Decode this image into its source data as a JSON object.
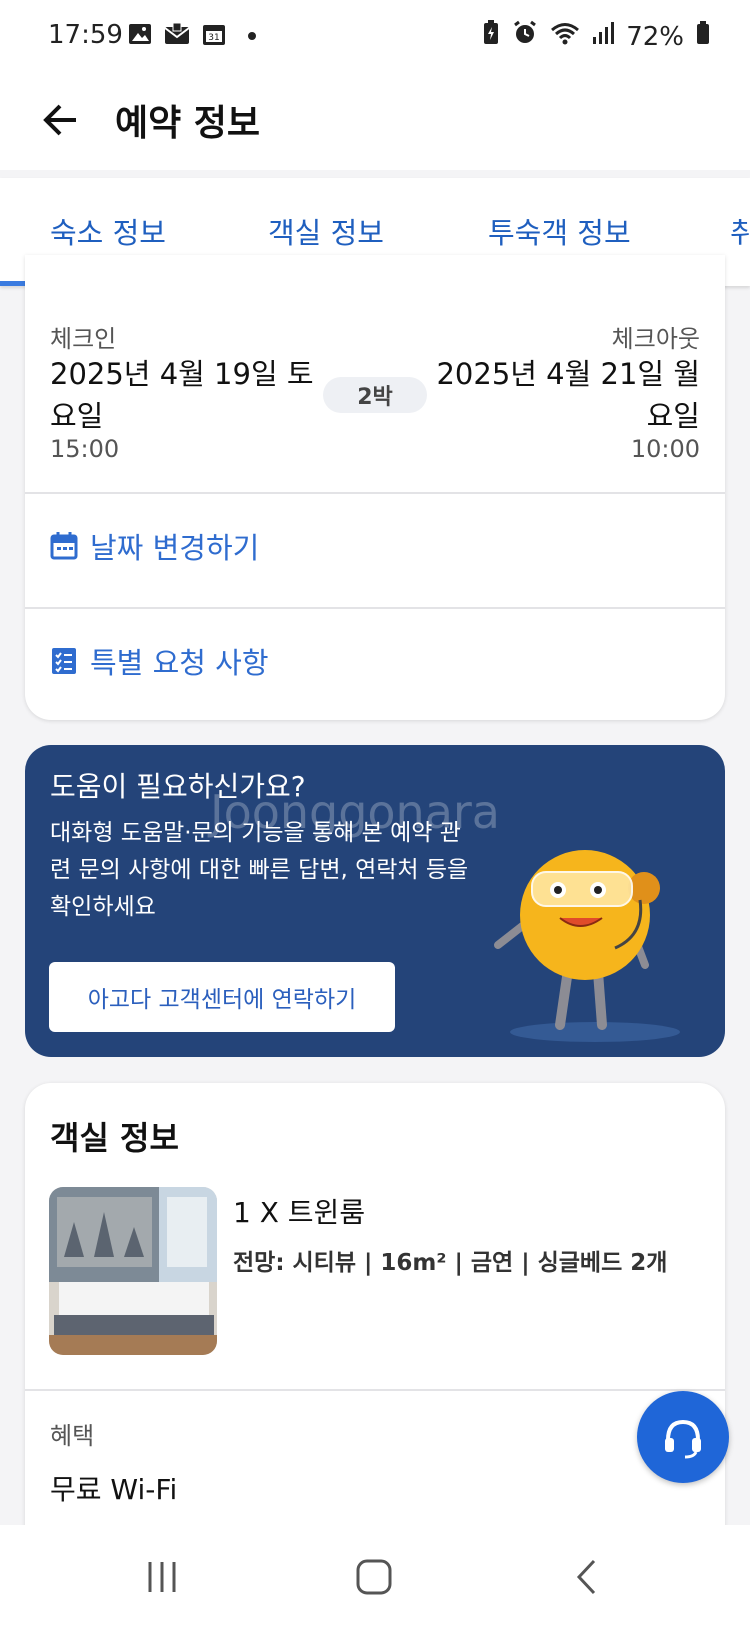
{
  "status_bar": {
    "time": "17:59",
    "battery": "72%",
    "left_icons": [
      "image-icon",
      "mail-icon",
      "calendar-icon"
    ],
    "right_icons": [
      "battery-saver-icon",
      "alarm-icon",
      "wifi-icon",
      "signal-icon"
    ]
  },
  "header": {
    "title": "예약 정보"
  },
  "tabs": [
    {
      "label": "숙소 정보",
      "active": true
    },
    {
      "label": "객실 정보",
      "active": false
    },
    {
      "label": "투숙객 정보",
      "active": false
    },
    {
      "label": "취",
      "active": false
    }
  ],
  "stay": {
    "checkin_label": "체크인",
    "checkin_date_line1": "2025년 4월 19일 토",
    "checkin_date_line2": "요일",
    "checkin_time": "15:00",
    "nights": "2박",
    "checkout_label": "체크아웃",
    "checkout_date_line1": "2025년 4월 21일 월",
    "checkout_date_line2": "요일",
    "checkout_time": "10:00",
    "change_date_label": "날짜 변경하기",
    "special_request_label": "특별 요청 사항"
  },
  "help": {
    "title": "도움이 필요하신가요?",
    "body": "대화형 도움말·문의 기능을 통해 본 예약 관련 문의 사항에 대한 빠른 답변, 연락처 등을 확인하세요",
    "button_label": "아고다 고객센터에 연락하기",
    "watermark": "Joonggonara",
    "colors": {
      "background": "#244479",
      "button_text": "#2b5fbd"
    }
  },
  "room": {
    "section_title": "객실 정보",
    "name": "1 X 트윈룸",
    "specs": "전망: 시티뷰 | 16m² | 금연 | 싱글베드 2개",
    "benefit_label": "혜택",
    "benefit_value": "무료 Wi-Fi"
  },
  "colors": {
    "accent": "#1f5fbf",
    "fab": "#1f66d8"
  }
}
